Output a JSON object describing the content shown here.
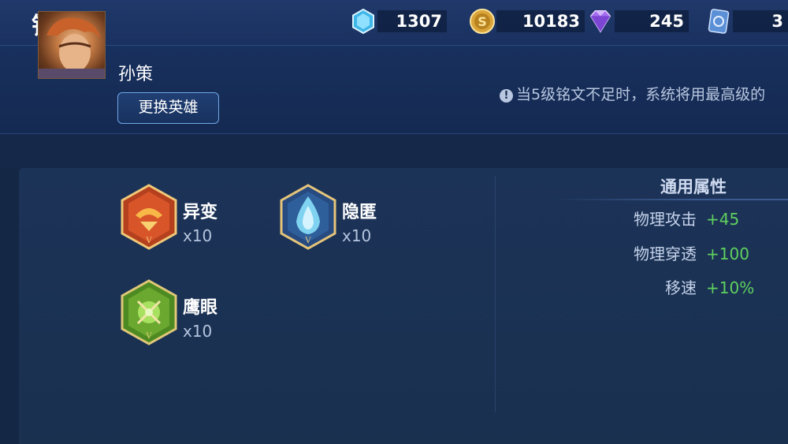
{
  "header": {
    "title": "铭文",
    "currencies": [
      {
        "icon": "crystal-icon",
        "value": "1307"
      },
      {
        "icon": "gold-coin-icon",
        "value": "10183"
      },
      {
        "icon": "diamond-icon",
        "value": "245"
      },
      {
        "icon": "card-icon",
        "value": "3"
      }
    ]
  },
  "hero": {
    "name": "孙策",
    "change_label": "更换英雄"
  },
  "notice": {
    "text": "当5级铭文不足时，系统将用最高级的"
  },
  "runes": [
    {
      "name": "异变",
      "count": "x10",
      "icon": "red-rune-icon"
    },
    {
      "name": "隐匿",
      "count": "x10",
      "icon": "blue-rune-icon"
    },
    {
      "name": "鹰眼",
      "count": "x10",
      "icon": "green-rune-icon"
    }
  ],
  "attributes": {
    "title": "通用属性",
    "items": [
      {
        "label": "物理攻击",
        "value": "+45"
      },
      {
        "label": "物理穿透",
        "value": "+100"
      },
      {
        "label": "移速",
        "value": "+10%"
      }
    ]
  },
  "colors": {
    "background": "#16284a",
    "positive": "#5fd05f",
    "accent": "#6fa7e6"
  }
}
